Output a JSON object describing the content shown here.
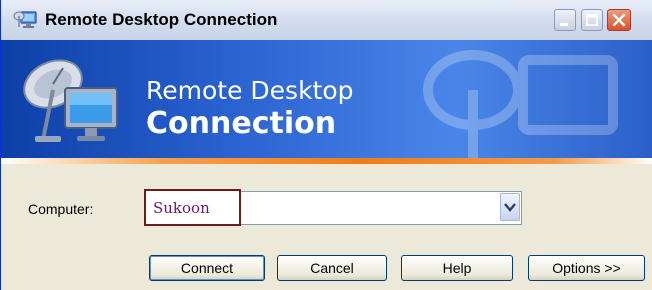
{
  "window": {
    "title": "Remote Desktop Connection",
    "title_icon": "remote-desktop-icon",
    "controls": [
      "minimize-icon",
      "maximize-icon",
      "close-icon"
    ]
  },
  "banner": {
    "line1": "Remote Desktop",
    "line2": "Connection",
    "logo_icon": "remote-desktop-computer-icon"
  },
  "form": {
    "computer_label": "Computer:",
    "computer_value": "Sukoon",
    "dropdown_icon": "chevron-down-icon"
  },
  "buttons": {
    "connect": "Connect",
    "cancel": "Cancel",
    "help": "Help",
    "options": "Options >>"
  },
  "colors": {
    "banner_dark": "#0d3fa7",
    "banner_light": "#4a86e8",
    "accent_orange": "#f07c1a",
    "highlight_border": "#6d1b1b",
    "computer_text": "#6a1a6a"
  }
}
